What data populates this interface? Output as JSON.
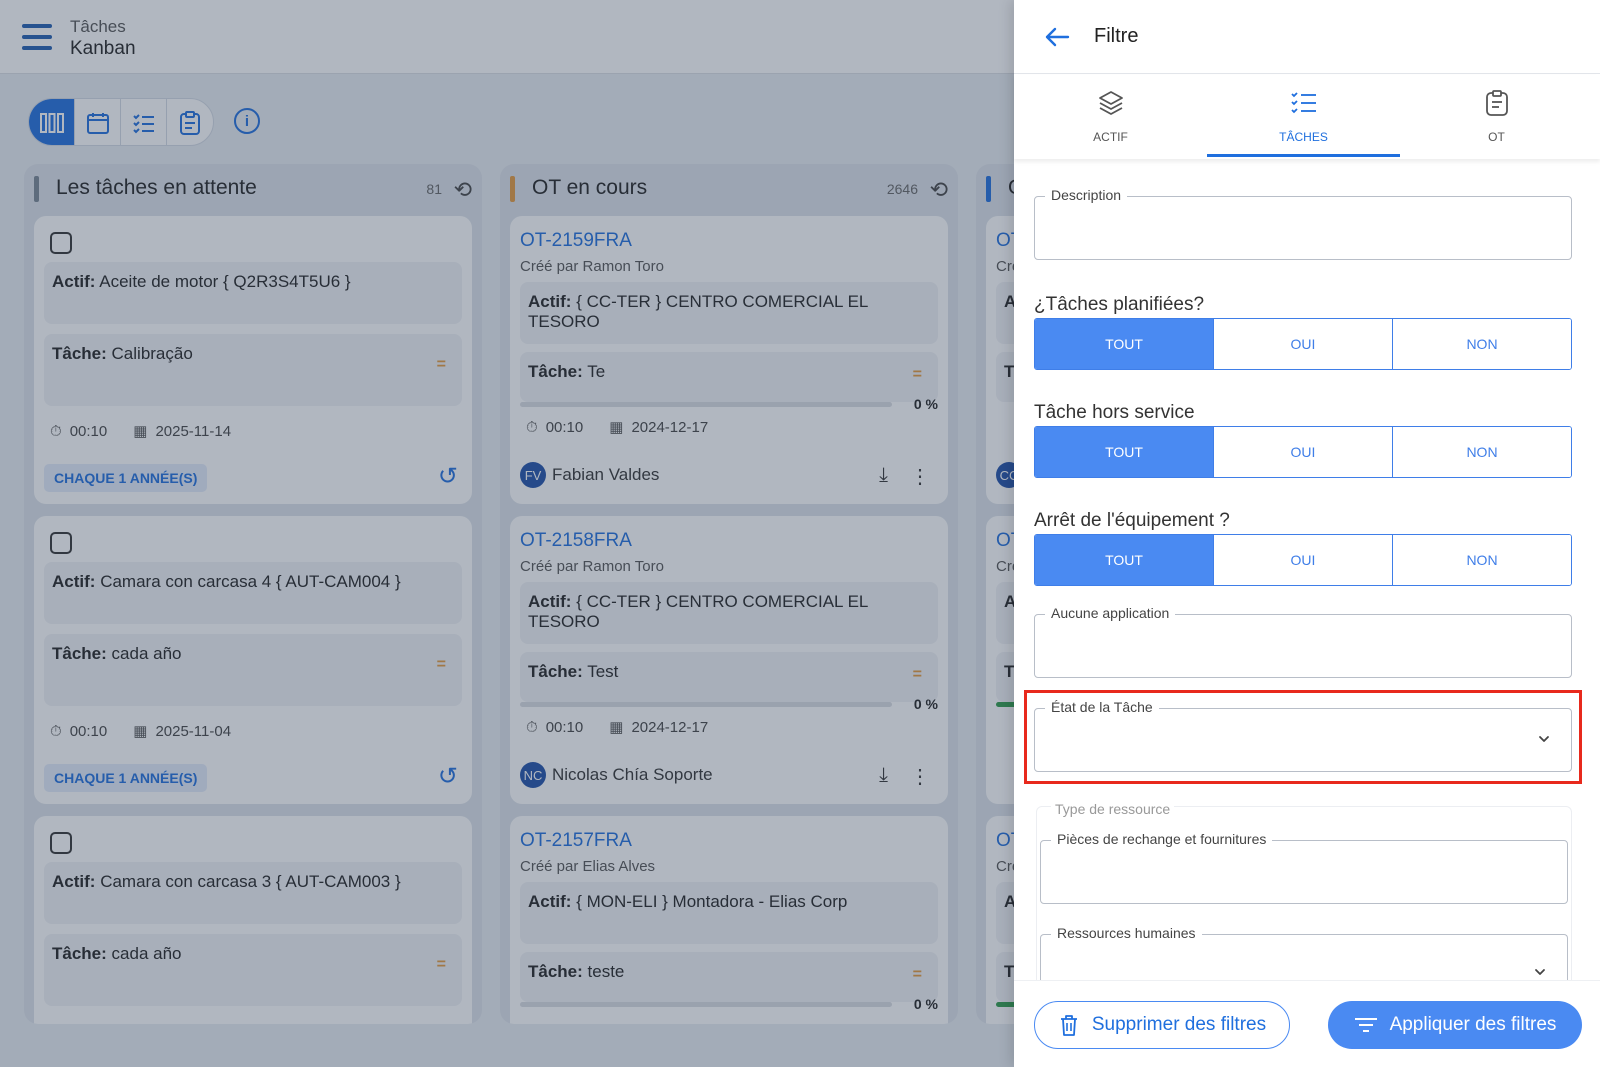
{
  "header": {
    "section": "Tâches",
    "view": "Kanban"
  },
  "columns": [
    {
      "title": "Les tâches en attente",
      "count": "81",
      "accent": "#7a8694",
      "cards": [
        {
          "asset_label": "Actif:",
          "asset": "Aceite de motor { Q2R3S4T5U6 }",
          "task_label": "Tâche:",
          "task": "Calibração",
          "priority": "=",
          "duration": "00:10",
          "date": "2025-11-14",
          "frequency": "CHAQUE 1 ANNÉE(S)"
        },
        {
          "asset_label": "Actif:",
          "asset": "Camara con carcasa 4   { AUT-CAM004 }",
          "task_label": "Tâche:",
          "task": "cada año",
          "priority": "=",
          "duration": "00:10",
          "date": "2025-11-04",
          "frequency": "CHAQUE 1 ANNÉE(S)"
        },
        {
          "asset_label": "Actif:",
          "asset": "Camara con carcasa 3   { AUT-CAM003 }",
          "task_label": "Tâche:",
          "task": "cada año",
          "priority": "="
        }
      ]
    },
    {
      "title": "OT en cours",
      "count": "2646",
      "accent": "#e59a3d",
      "cards": [
        {
          "code": "OT-2159FRA",
          "creator": "Créé par Ramon Toro",
          "asset_label": "Actif:",
          "asset": "{ CC-TER } CENTRO COMERCIAL EL TESORO",
          "task_label": "Tâche:",
          "task": "Te",
          "priority": "=",
          "progress": "0 %",
          "duration": "00:10",
          "date": "2024-12-17",
          "initials": "FV",
          "user": "Fabian Valdes"
        },
        {
          "code": "OT-2158FRA",
          "creator": "Créé par Ramon Toro",
          "asset_label": "Actif:",
          "asset": "{ CC-TER } CENTRO COMERCIAL EL TESORO",
          "task_label": "Tâche:",
          "task": "Test",
          "priority": "=",
          "progress": "0 %",
          "duration": "00:10",
          "date": "2024-12-17",
          "initials": "NC",
          "user": "Nicolas Chía Soporte"
        },
        {
          "code": "OT-2157FRA",
          "creator": "Créé par Elias Alves",
          "asset_label": "Actif:",
          "asset": "{ MON-ELI } Montadora - Elias Corp",
          "task_label": "Tâche:",
          "task": "teste",
          "priority": "=",
          "progress": "0 %"
        }
      ]
    },
    {
      "title": "O",
      "accent": "#1f6fde",
      "cards": [
        {
          "code": "OT",
          "creator": "Cre",
          "asset_label": "A",
          "task_label": "T",
          "initials": "CC"
        },
        {
          "code": "OT",
          "creator": "Cre",
          "asset_label": "A",
          "task_label": "T"
        },
        {
          "code": "OT",
          "creator": "Cre",
          "asset_label": "A",
          "task_label": "T"
        }
      ]
    }
  ],
  "filter": {
    "title": "Filtre",
    "tabs": [
      {
        "label": "ACTIF",
        "icon": "layers-icon"
      },
      {
        "label": "TÂCHES",
        "icon": "checklist-icon",
        "active": true
      },
      {
        "label": "OT",
        "icon": "clipboard-icon"
      }
    ],
    "description_label": "Description",
    "planned": {
      "label": "¿Tâches planifiées?",
      "options": [
        "TOUT",
        "OUI",
        "NON"
      ],
      "selected": "TOUT"
    },
    "out_of_service": {
      "label": "Tâche hors service",
      "options": [
        "TOUT",
        "OUI",
        "NON"
      ],
      "selected": "TOUT"
    },
    "equipment_stop": {
      "label": "Arrêt de l'équipement ?",
      "options": [
        "TOUT",
        "OUI",
        "NON"
      ],
      "selected": "TOUT"
    },
    "application_label": "Aucune application",
    "task_state_label": "État de la Tâche",
    "resource_type_label": "Type de ressource",
    "parts_label": "Pièces de rechange et fournitures",
    "human_resources_label": "Ressources humaines",
    "clear_button": "Supprimer des filtres",
    "apply_button": "Appliquer des filtres"
  },
  "colors": {
    "primary": "#1f6fde",
    "segment_selected": "#4a8af2",
    "highlight": "#e8291c"
  }
}
